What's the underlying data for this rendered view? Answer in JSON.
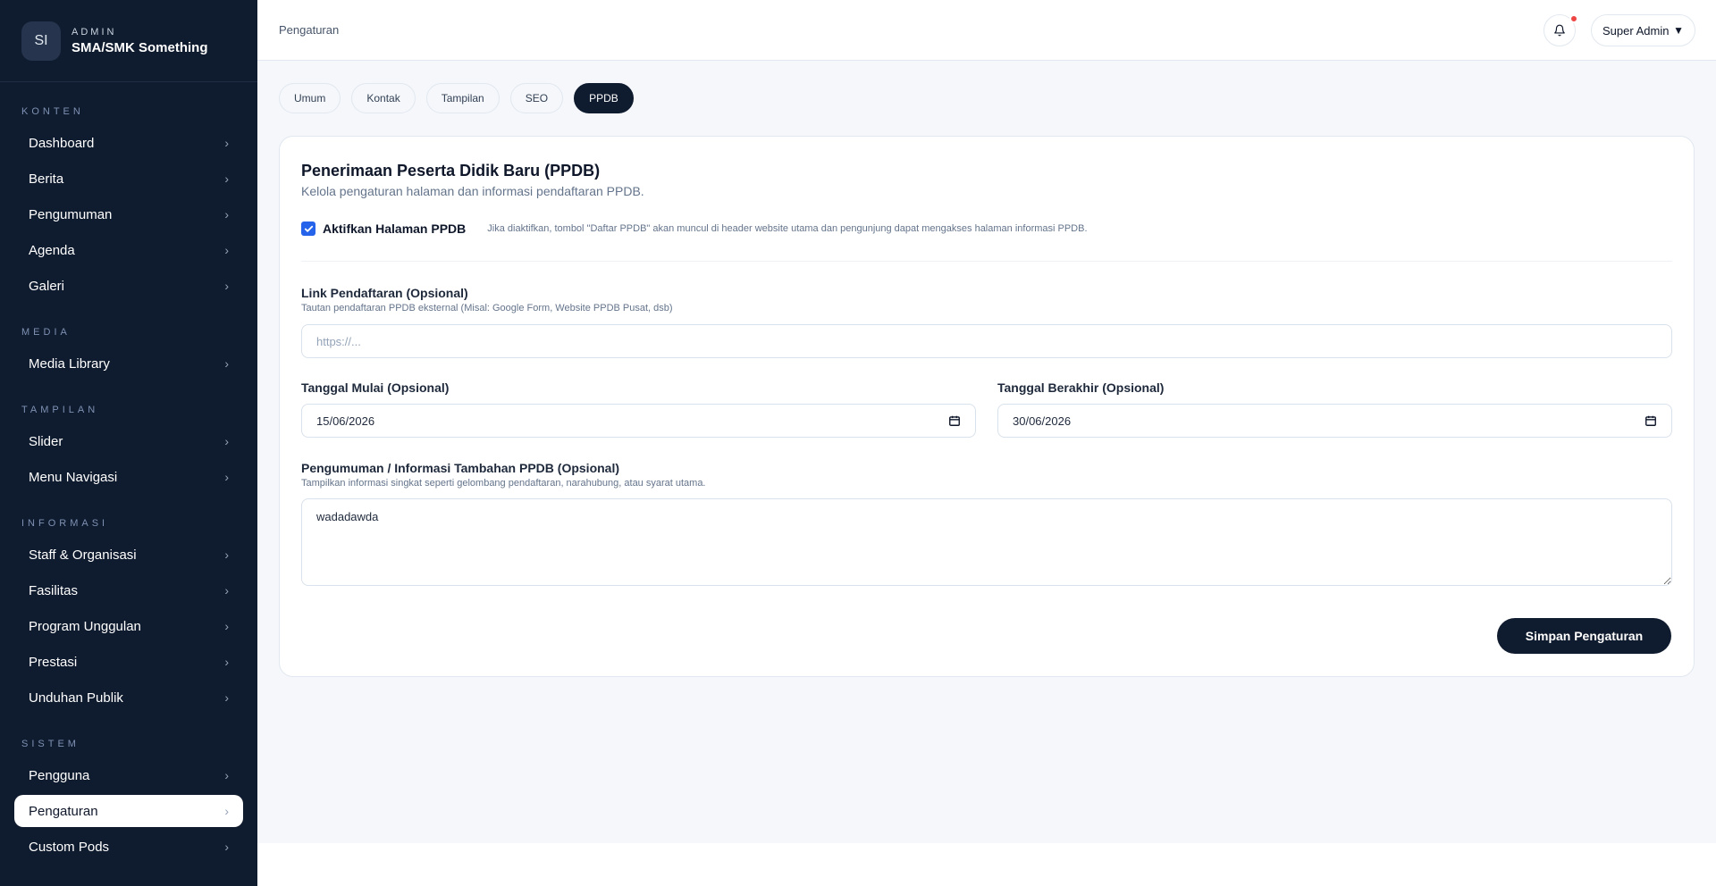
{
  "brand": {
    "initials": "SI",
    "role": "ADMIN",
    "name": "SMA/SMK Something"
  },
  "sidebar": {
    "sections": [
      {
        "title": "KONTEN",
        "items": [
          "Dashboard",
          "Berita",
          "Pengumuman",
          "Agenda",
          "Galeri"
        ]
      },
      {
        "title": "MEDIA",
        "items": [
          "Media Library"
        ]
      },
      {
        "title": "TAMPILAN",
        "items": [
          "Slider",
          "Menu Navigasi"
        ]
      },
      {
        "title": "INFORMASI",
        "items": [
          "Staff & Organisasi",
          "Fasilitas",
          "Program Unggulan",
          "Prestasi",
          "Unduhan Publik"
        ]
      },
      {
        "title": "SISTEM",
        "items": [
          "Pengguna",
          "Pengaturan",
          "Custom Pods"
        ]
      }
    ],
    "active_item": "Pengaturan",
    "chevron": "›"
  },
  "header": {
    "breadcrumb": "Pengaturan",
    "user": "Super Admin",
    "user_caret": "▼",
    "icons": {
      "bell": "bell-icon",
      "notification": "notification-dot"
    }
  },
  "tabs": [
    "Umum",
    "Kontak",
    "Tampilan",
    "SEO",
    "PPDB"
  ],
  "active_tab": "PPDB",
  "ppdb": {
    "title": "Penerimaan Peserta Didik Baru (PPDB)",
    "subtitle": "Kelola pengaturan halaman dan informasi pendaftaran PPDB.",
    "toggle_label": "Aktifkan Halaman PPDB",
    "toggle_checked": true,
    "toggle_help": "Jika diaktifkan, tombol \"Daftar PPDB\" akan muncul di header website utama dan pengunjung dapat mengakses halaman informasi PPDB.",
    "link": {
      "label": "Link Pendaftaran (Opsional)",
      "help": "Tautan pendaftaran PPDB eksternal (Misal: Google Form, Website PPDB Pusat, dsb)",
      "placeholder": "https://...",
      "value": ""
    },
    "start_date": {
      "label": "Tanggal Mulai (Opsional)",
      "value": "15/06/2026"
    },
    "end_date": {
      "label": "Tanggal Berakhir (Opsional)",
      "value": "30/06/2026"
    },
    "announcement": {
      "label": "Pengumuman / Informasi Tambahan PPDB (Opsional)",
      "help": "Tampilkan informasi singkat seperti gelombang pendaftaran, narahubung, atau syarat utama.",
      "value": "wadadawda"
    },
    "save_label": "Simpan Pengaturan"
  },
  "colors": {
    "sidebar_bg": "#0f1b2e",
    "accent_dark": "#0f1b2e",
    "checkbox": "#2563eb",
    "notification": "#ef4444",
    "main_bg": "#f5f7fb"
  }
}
